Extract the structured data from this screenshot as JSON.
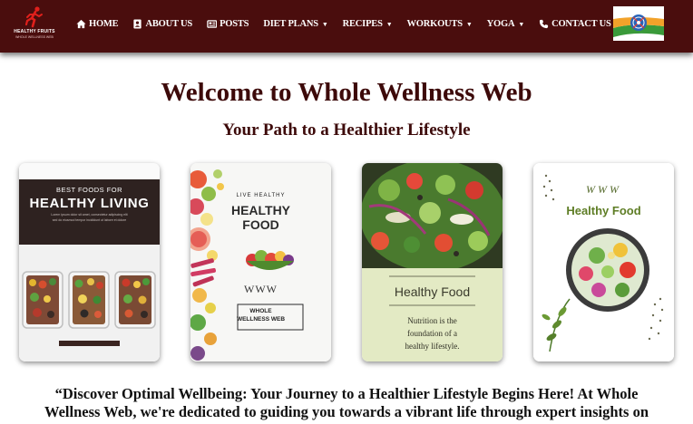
{
  "header": {
    "logo": {
      "name": "HEALTHY FRUITS",
      "tagline": "WHOLE WELLNESS WEB"
    },
    "nav": [
      {
        "label": "HOME",
        "icon": "home-icon",
        "dropdown": false
      },
      {
        "label": "ABOUT US",
        "icon": "contact-card-icon",
        "dropdown": false
      },
      {
        "label": "POSTS",
        "icon": "newspaper-icon",
        "dropdown": false
      },
      {
        "label": "DIET PLANS",
        "icon": "",
        "dropdown": true
      },
      {
        "label": "RECIPES",
        "icon": "",
        "dropdown": true
      },
      {
        "label": "WORKOUTS",
        "icon": "",
        "dropdown": true
      },
      {
        "label": "YOGA",
        "icon": "",
        "dropdown": true
      },
      {
        "label": "CONTACT US",
        "icon": "phone-icon",
        "dropdown": false
      }
    ],
    "translate_icon": "google-translate-icon"
  },
  "hero": {
    "title": "Welcome to Whole Wellness Web",
    "subtitle": "Your Path to a Healthier Lifestyle"
  },
  "cards": [
    {
      "heading_small": "BEST FOODS FOR",
      "heading_large": "HEALTHY LIVING",
      "caption_1": "Lorem ipsum dolor sit amet, consectetur adipiscing elit",
      "caption_2": "sed do eiusmod tempor incididunt ut labore et dolore"
    },
    {
      "heading_small": "LIVE   HEALTHY",
      "heading_large_1": "HEALTHY",
      "heading_large_2": "FOOD",
      "mark": "WWW",
      "badge_1": "WHOLE",
      "badge_2": "WELLNESS WEB"
    },
    {
      "title": "Healthy Food",
      "caption_1": "Nutrition is the",
      "caption_2": "foundation of a",
      "caption_3": "healthy lifestyle."
    },
    {
      "mark": "WWW",
      "title": "Healthy Food"
    }
  ],
  "intro": {
    "line_1": "“Discover Optimal Wellbeing: Your Journey to a Healthier Lifestyle Begins Here! At Whole",
    "line_2": "Wellness Web, we're dedicated to guiding you towards a vibrant life through expert insights on"
  },
  "colors": {
    "navbar": "#4a0d0d",
    "heading": "#3d0a0a",
    "logo_red": "#e0201c",
    "card3_panel": "#e3eac4",
    "card4_title": "#5e7d25"
  }
}
